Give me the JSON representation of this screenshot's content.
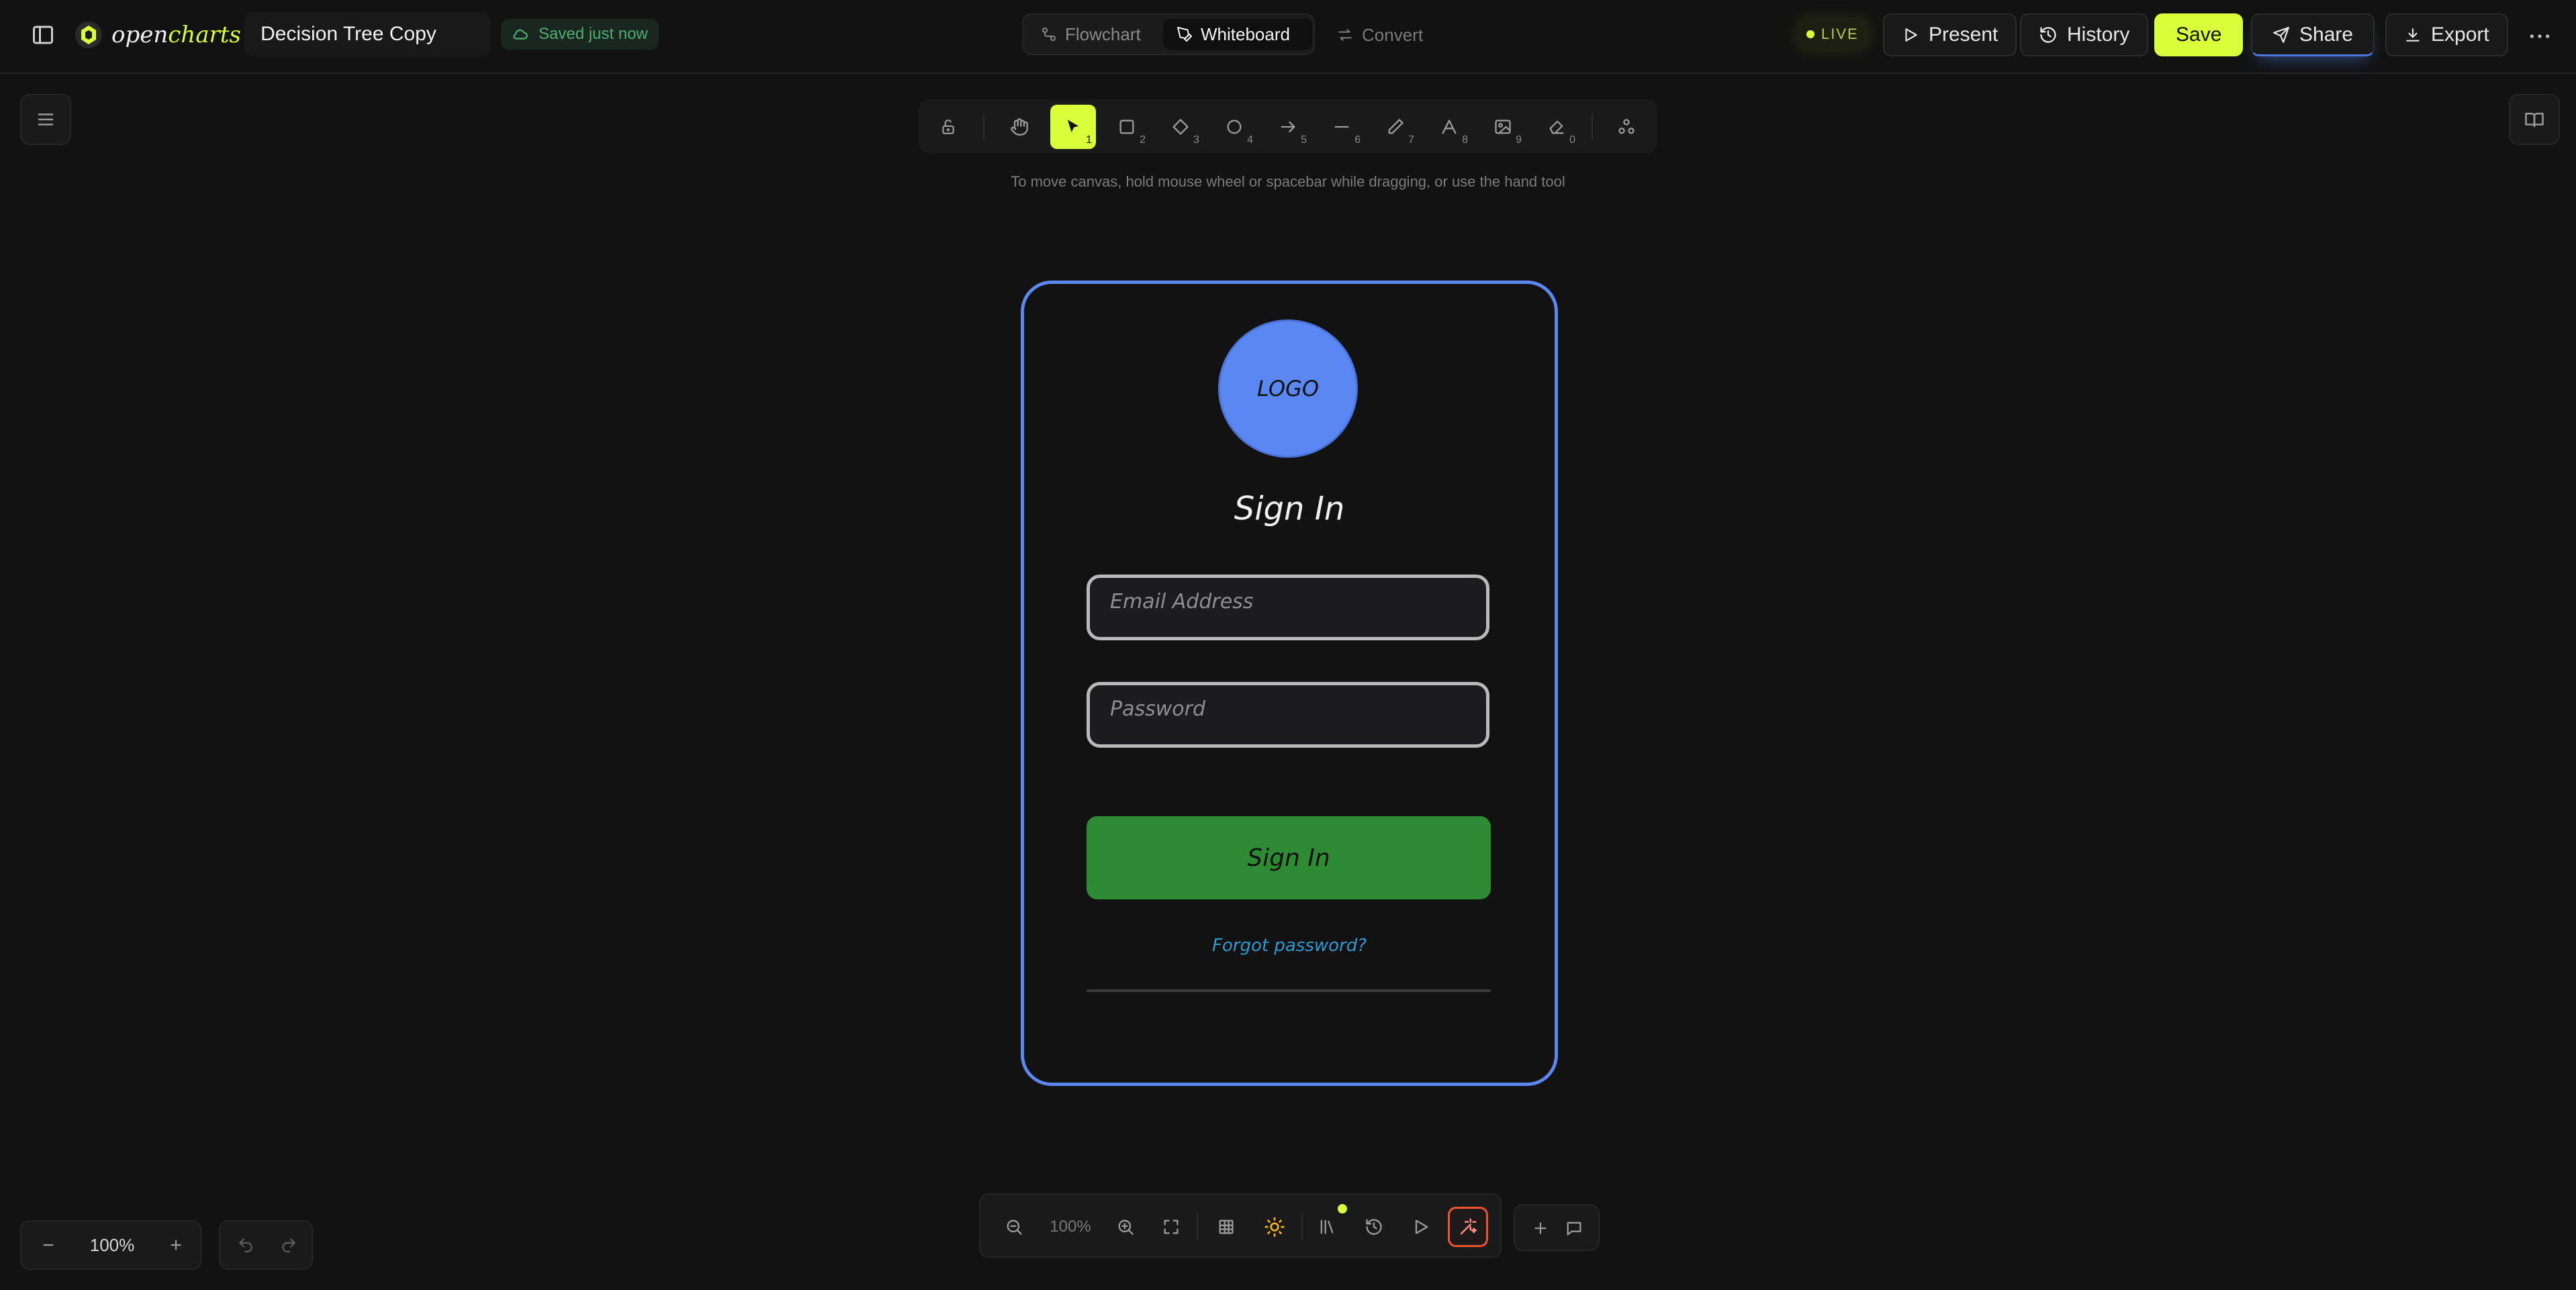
{
  "app": {
    "logo_text_open": "open",
    "logo_text_charts": "charts",
    "document_title": "Decision Tree Copy",
    "save_status": "Saved just now"
  },
  "modes": {
    "flowchart": "Flowchart",
    "whiteboard": "Whiteboard",
    "convert": "Convert"
  },
  "header_actions": {
    "live": "LIVE",
    "present": "Present",
    "history": "History",
    "save": "Save",
    "share": "Share",
    "export": "Export"
  },
  "toolbar": {
    "tools": [
      {
        "name": "hand",
        "key": ""
      },
      {
        "name": "selection",
        "key": "1"
      },
      {
        "name": "rectangle",
        "key": "2"
      },
      {
        "name": "diamond",
        "key": "3"
      },
      {
        "name": "ellipse",
        "key": "4"
      },
      {
        "name": "arrow",
        "key": "5"
      },
      {
        "name": "line",
        "key": "6"
      },
      {
        "name": "draw",
        "key": "7"
      },
      {
        "name": "text",
        "key": "8"
      },
      {
        "name": "image",
        "key": "9"
      },
      {
        "name": "eraser",
        "key": "0"
      }
    ],
    "hint": "To move canvas, hold mouse wheel or spacebar while dragging, or use the hand tool"
  },
  "sketch": {
    "logo": "LOGO",
    "heading": "Sign In",
    "email_placeholder": "Email Address",
    "password_placeholder": "Password",
    "button": "Sign In",
    "forgot": "Forgot password?"
  },
  "zoom": {
    "left_level": "100%",
    "center_level": "100%"
  },
  "colors": {
    "accent": "#d8ff3a",
    "frame": "#5a87f0",
    "logo_fill": "#5b87f2",
    "signin_button": "#2e8b34",
    "forgot_link": "#2f9ad1",
    "saved_status": "#4caf6e"
  }
}
